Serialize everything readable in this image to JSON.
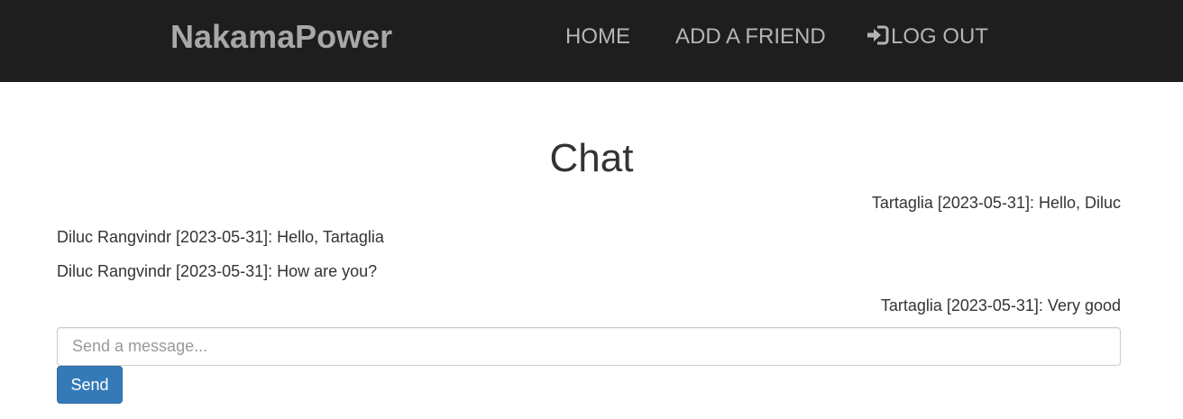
{
  "navbar": {
    "brand": "NakamaPower",
    "links": {
      "home": "HOME",
      "add_friend": "ADD A FRIEND",
      "logout": "LOG OUT",
      "logout_icon": "log-in-icon"
    },
    "background": "#1e1e1e",
    "text_color": "#b5b5b5"
  },
  "main": {
    "title": "Chat",
    "messages": [
      {
        "text": "Tartaglia [2023-05-31]: Hello, Diluc",
        "align": "right"
      },
      {
        "text": "Diluc Rangvindr [2023-05-31]: Hello, Tartaglia",
        "align": "left"
      },
      {
        "text": "Diluc Rangvindr [2023-05-31]: How are you?",
        "align": "left"
      },
      {
        "text": "Tartaglia [2023-05-31]: Very good",
        "align": "right"
      }
    ],
    "input": {
      "placeholder": "Send a message...",
      "value": ""
    },
    "send_label": "Send",
    "accent": "#337ab7"
  }
}
